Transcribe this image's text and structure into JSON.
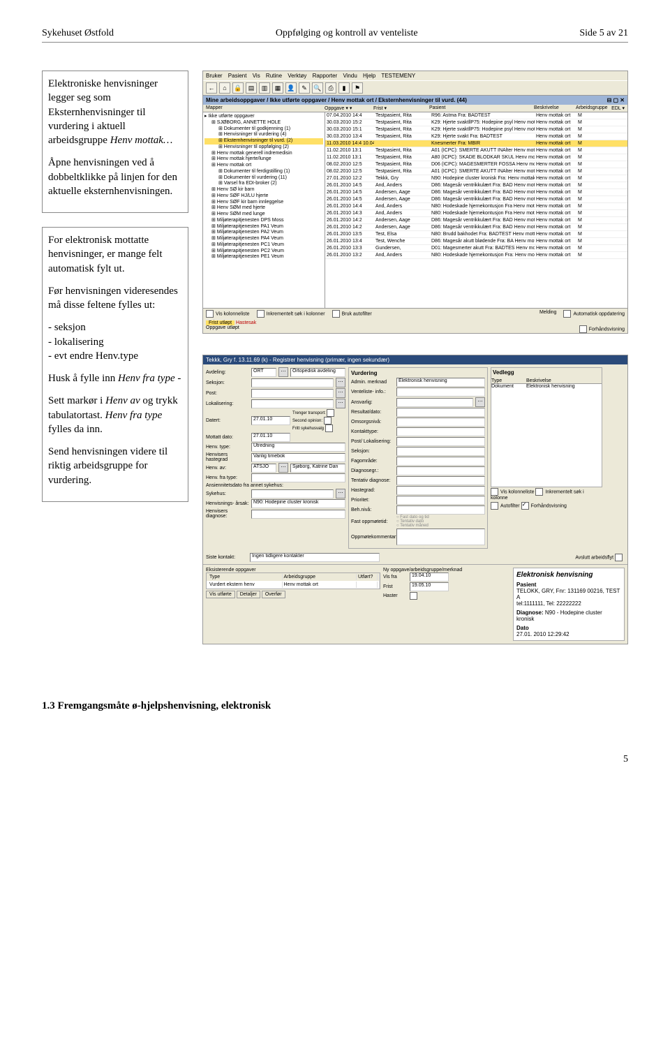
{
  "header": {
    "left": "Sykehuset Østfold",
    "center": "Oppfølging og kontroll av venteliste",
    "right": "Side 5 av 21"
  },
  "left": {
    "p1a": "Elektroniske henvisninger legger seg som Eksternhenvisninger til vurdering i aktuell arbeidsgruppe ",
    "p1i": "Henv mottak…",
    "p2": "Åpne henvisningen ved å dobbeltklikke på linjen for den aktuelle eksternhenvisningen.",
    "p3": "For elektronisk mottatte henvisninger, er mange felt automatisk fylt ut.",
    "p4": "Før henvisningen videresendes må disse feltene fylles ut:",
    "li1": "seksjon",
    "li2": "lokalisering",
    "li3": "evt endre Henv.type",
    "p5a": "Husk å fylle inn ",
    "p5i": "Henv fra type",
    "p5b": " - ",
    "p6a": "Sett markør i ",
    "p6i": "Henv av",
    "p6b": " og trykk tabulatortast. ",
    "p6i2": "Henv fra type",
    "p6c": " fylles da inn.",
    "p7": "Send henvisningen videre til riktig arbeidsgruppe for vurdering."
  },
  "app1": {
    "menu": [
      "Bruker",
      "Pasient",
      "Vis",
      "Rutine",
      "Verktøy",
      "Rapporter",
      "Vindu",
      "Hjelp",
      "TESTEMENY"
    ],
    "breadcrumb": "Mine arbeidsoppgaver / Ikke utførte oppgaver / Henv mottak ort / Eksternhenvisninger til vurd. (44)",
    "mapper": "Mapper",
    "listhead_oppgave": "Oppgave ▾ ▾",
    "listhead_frist": "Frist ▾",
    "listhead_pasient": "Pasient",
    "listhead_beskr": "Beskrivelse",
    "listhead_arb": "Arbeidsgruppe",
    "edl": "EDL ▾",
    "tree": [
      {
        "t": "Ikke utførte oppgaver",
        "lvl": 0
      },
      {
        "t": "SJØBORG, ANNETTE HOLE",
        "lvl": 1
      },
      {
        "t": "Dokumenter til godkjenning (1)",
        "lvl": 2
      },
      {
        "t": "Henvisninger til vurdering (4)",
        "lvl": 2
      },
      {
        "t": "Eksternhenvisninger til vurd. (2)",
        "lvl": 2,
        "hl": true
      },
      {
        "t": "Henvisninger til oppfølging (2)",
        "lvl": 2
      },
      {
        "t": "Henv mottak generell indremedisin",
        "lvl": 1
      },
      {
        "t": "Henv mottak hjerte/lunge",
        "lvl": 1
      },
      {
        "t": "Henv mottak ort",
        "lvl": 1
      },
      {
        "t": "Dokumenter til ferdigstilling (1)",
        "lvl": 2
      },
      {
        "t": "Dokumenter til vurdering (11)",
        "lvl": 2
      },
      {
        "t": "Varsel fra EDI-broker (2)",
        "lvl": 2
      },
      {
        "t": "Henv SØ kir barn",
        "lvl": 1
      },
      {
        "t": "Henv SØF HJ/LU hjerte",
        "lvl": 1
      },
      {
        "t": "Henv SØF kir barn innleggelse",
        "lvl": 1
      },
      {
        "t": "Henv SØM med hjerte",
        "lvl": 1
      },
      {
        "t": "Henv SØM med lunge",
        "lvl": 1
      },
      {
        "t": "Miljøterapitjenesten DPS Moss",
        "lvl": 1
      },
      {
        "t": "Miljøterapitjenesten PA1 Veum",
        "lvl": 1
      },
      {
        "t": "Miljøterapitjenesten PA2 Veum",
        "lvl": 1
      },
      {
        "t": "Miljøterapitjenesten PA4 Veum",
        "lvl": 1
      },
      {
        "t": "Miljøterapitjenesten PC1 Veum",
        "lvl": 1
      },
      {
        "t": "Miljøterapitjenesten PC2 Veum",
        "lvl": 1
      },
      {
        "t": "Miljøterapitjenesten PE1 Veum",
        "lvl": 1
      }
    ],
    "rows": [
      {
        "d": "07.04.2010 14:4",
        "p": "Testpasient, Rita",
        "b": "R96: Astma Fra: BADTEST",
        "a": "Henv mottak ort",
        "m": "M"
      },
      {
        "d": "30.03.2010 15:2",
        "p": "Testpasient, Rita",
        "b": "K29: Hjerte svakt‖P75: Hodepine psyl Henv mottak ort",
        "a": "Henv mottak ort",
        "m": "M"
      },
      {
        "d": "30.03.2010 15:1",
        "p": "Testpasient, Rita",
        "b": "K29: Hjerte svakt‖P75: Hodepine psyl Henv mottak ort",
        "a": "Henv mottak ort",
        "m": "M"
      },
      {
        "d": "30.03.2010 13:4",
        "p": "Testpasient, Rita",
        "b": "K29: Hjerte svakt Fra: BADTEST",
        "a": "Henv mottak ort",
        "m": "M"
      },
      {
        "d": "11.03.2010 14:4 10.04.10",
        "p": "",
        "b": "Knesmerter Fra: MBIR",
        "a": "Henv mottak ort",
        "m": "M",
        "hl": true
      },
      {
        "d": "11.02.2010 13:1",
        "p": "Testpasient, Rita",
        "b": "A01 (ICPC): SMERTE AKUTT INAlter Henv mottak ort",
        "a": "Henv mottak ort",
        "m": "M"
      },
      {
        "d": "11.02.2010 13:1",
        "p": "Testpasient, Rita",
        "b": "A80 (ICPC): SKADE BLODKAR SKUL Henv mottak ort",
        "a": "Henv mottak ort",
        "m": "M"
      },
      {
        "d": "08.02.2010 12:5",
        "p": "Testpasient, Rita",
        "b": "D06 (ICPC): MAGESMERTER FOSSA Henv mottak ort",
        "a": "Henv mottak ort",
        "m": "M"
      },
      {
        "d": "08.02.2010 12:5",
        "p": "Testpasient, Rita",
        "b": "A01 (ICPC): SMERTE AKUTT INAlter Henv mottak ort",
        "a": "Henv mottak ort",
        "m": "M"
      },
      {
        "d": "27.01.2010 12:2",
        "p": "Tekkk, Gry",
        "b": "N90: Hodepine cluster kronisk Fra: Henv mottak ort",
        "a": "Henv mottak ort",
        "m": "M"
      },
      {
        "d": "26.01.2010 14:5",
        "p": "And, Anders",
        "b": "D86: Magesår ventrikkulært Fra: BAD Henv mottak ort",
        "a": "Henv mottak ort",
        "m": "M"
      },
      {
        "d": "26.01.2010 14:5",
        "p": "Andersen, Aage",
        "b": "D86: Magesår ventrikkulært Fra: BAD Henv mottak ort",
        "a": "Henv mottak ort",
        "m": "M"
      },
      {
        "d": "26.01.2010 14:5",
        "p": "Andersen, Aage",
        "b": "D86: Magesår ventrikkulært Fra: BAD Henv mottak ort",
        "a": "Henv mottak ort",
        "m": "M"
      },
      {
        "d": "26.01.2010 14:4",
        "p": "And, Anders",
        "b": "N80: Hodeskade hjernekontusjon Fra Henv mottak ort",
        "a": "Henv mottak ort",
        "m": "M"
      },
      {
        "d": "26.01.2010 14:3",
        "p": "And, Anders",
        "b": "N80: Hodeskade hjernekontusjon Fra Henv mottak ort",
        "a": "Henv mottak ort",
        "m": "M"
      },
      {
        "d": "26.01.2010 14:2",
        "p": "Andersen, Aage",
        "b": "D86: Magesår ventrikkulært Fra: BAD Henv mottak ort",
        "a": "Henv mottak ort",
        "m": "M"
      },
      {
        "d": "26.01.2010 14:2",
        "p": "Andersen, Aage",
        "b": "D86: Magesår ventrikkulært Fra: BAD Henv mottak ort",
        "a": "Henv mottak ort",
        "m": "M"
      },
      {
        "d": "26.01.2010 13:5",
        "p": "Test, Elsa",
        "b": "N80: Brudd bakhodet Fra: BADTEST Henv mottak ort",
        "a": "Henv mottak ort",
        "m": "M"
      },
      {
        "d": "26.01.2010 13:4",
        "p": "Test, Wenche",
        "b": "D86: Magesår akutt blødende Fra: BA Henv mottak ort",
        "a": "Henv mottak ort",
        "m": "M"
      },
      {
        "d": "26.01.2010 13:3",
        "p": "Gundersen,",
        "b": "D01: Magesmerter akutt Fra: BADTES Henv mottak ort",
        "a": "Henv mottak ort",
        "m": "M"
      },
      {
        "d": "26.01.2010 13:2",
        "p": "And, Anders",
        "b": "N80: Hodeskade hjernekontusjon Fra: Henv mottak ort",
        "a": "Henv mottak ort",
        "m": "M"
      }
    ],
    "status_vis": "Vis kolonneliste",
    "status_inkr": "Inkrementelt søk i kolonner",
    "status_bruk": "Bruk autofilter",
    "status_melding": "Melding",
    "status_auto": "Automatisk oppdatering",
    "legend_frist": "Frist utløpt",
    "legend_haste": "Hastesak",
    "legend_oppg": "Oppgave utløpt",
    "legend_forh": "Forhåndsvisning"
  },
  "form": {
    "title": "Tekkk, Gry f. 13.11.69 (k) - Registrer henvisning (primær, ingen sekundær)",
    "avdeling_lbl": "Avdeling:",
    "avdeling_code": "ORT",
    "avdeling_txt": "Ortopedisk avdeling",
    "seksjon_lbl": "Seksjon:",
    "post_lbl": "Post:",
    "lokal_lbl": "Lokalisering:",
    "datert_lbl": "Datert:",
    "datert": "27.01.10",
    "mottatt_lbl": "Mottatt dato:",
    "mottatt": "27.01.10",
    "henvtype_lbl": "Henv. type:",
    "henvtype": "Utredning",
    "haste_lbl": "Henvisers hastegrad",
    "haste": "Vanlig timebok",
    "henvav_lbl": "Henv. av:",
    "henvav_code": "ATSJO",
    "henvav_txt": "Sjøborg, Katrine Dan",
    "fratype_lbl": "Henv. fra type:",
    "ansienn_lbl": "Ansiennitetsdato fra annet sykehus:",
    "sykehus_lbl": "Sykehus:",
    "harsak_lbl": "Henvisnings- årsak:",
    "harsak": "N90: Hodepine cluster kronisk",
    "hdiag_lbl": "Henvisers diagnose:",
    "trenger": "Trenger transport:",
    "second": "Second opinion:",
    "fritt": "Fritt sykehusvalg",
    "vurd_title": "Vurdering",
    "admin_lbl": "Admin. merknad",
    "admin_val": "Elektronisk henvisning",
    "vl_lbl": "Venteliste- info.:",
    "ansvar_lbl": "Ansvarlig:",
    "result_lbl": "Resultat/dato:",
    "oms_lbl": "Omsorgsnivå:",
    "ktype_lbl": "Kontakttype:",
    "postlok_lbl": "Post/ Lokalisering:",
    "seksjon2_lbl": "Seksjon:",
    "fag_lbl": "Fagområde:",
    "dgr_lbl": "Diagnosegr.:",
    "tent_lbl": "Tentativ diagnose:",
    "hgrad_lbl": "Hastegrad:",
    "pri_lbl": "Prioritet:",
    "beh_lbl": "Beh.nivå:",
    "fast_lbl": "Fast oppmøtetid:",
    "fast1": "Fast dato og tid",
    "fast2": "Tentativ dato",
    "fast3": "Tentativ måned",
    "komm_lbl": "Oppmøtekommentar:",
    "vedlegg_title": "Vedlegg",
    "vedlegg_type": "Type",
    "vedlegg_besk": "Beskrivelse",
    "vedlegg_row_type": "Dokument",
    "vedlegg_row_besk": "Elektronisk henvisning",
    "chk_vis": "Vis kolonneliste",
    "chk_inkr": "Inkrementelt søk i kolonne",
    "chk_autof": "Autofilter",
    "chk_forh": "Forhåndsvisning",
    "siste_lbl": "Siste kontakt:",
    "siste_val": "Ingen tidligere kontakter",
    "eks_title": "Eksisterende oppgaver",
    "eks_type": "Type",
    "eks_arb": "Arbeidsgruppe",
    "eks_utf": "Utført?",
    "eks_row_type": "Vurdert ekstern henv",
    "eks_row_arb": "Henv mottak ort",
    "ny_title": "Ny oppgave/arbeidsgruppe/merknad",
    "avslutt_lbl": "Avslutt arbeidsflyt",
    "visfra_lbl": "Vis fra",
    "visfra": "19.04.10",
    "frist_lbl": "Frist",
    "frist": "19.05.10",
    "haster_lbl": "Haster",
    "btns": {
      "visutf": "Vis utførte",
      "detaljer": "Detaljer",
      "overfor": "Overfør"
    },
    "preview_title": "Elektronisk henvisning",
    "preview_pas": "Pasient",
    "preview_name": "TELOKK, GRY, Fnr: 131169 00216, TEST A",
    "preview_tel": "tel:1111111, Tel: 22222222",
    "preview_diag_lbl": "Diagnose:",
    "preview_diag": "N90 - Hodepine cluster kronisk",
    "preview_dato_lbl": "Dato",
    "preview_dato": "27.01. 2010 12:29:42"
  },
  "footer": {
    "heading": "1.3    Fremgangsmåte ø-hjelpshenvisning, elektronisk",
    "pageno": "5"
  }
}
